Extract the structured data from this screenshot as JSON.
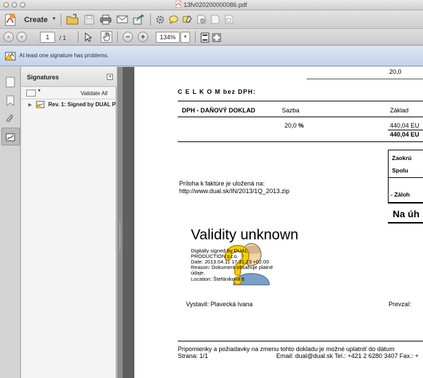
{
  "window": {
    "title": "13fv020200000086.pdf"
  },
  "toolbar": {
    "create_label": "Create",
    "page_current": "1",
    "page_total": "/ 1",
    "zoom": "134%"
  },
  "message_bar": {
    "text": "At least one signature has problems."
  },
  "signatures_panel": {
    "title": "Signatures",
    "validate_all": "Validate All",
    "entries": [
      {
        "label": "Rev. 1: Signed by DUAL P"
      }
    ]
  },
  "document": {
    "top_value": "20,0",
    "summary_heading": "C E L K O M  bez DPH:",
    "table": {
      "col_doc": "DPH - DAŇOVÝ DOKLAD",
      "col_rate": "Sazba",
      "col_base": "Základ",
      "rate": "20,0",
      "rate_unit": "%",
      "base_value": "440,04 EU",
      "base_total": "440,04 EU"
    },
    "right_labels": {
      "rounding": "Zaokrú",
      "total": "Spolu",
      "advance": "- Záloh",
      "to_pay": "Na úh"
    },
    "attachment_note": "Príloha k faktúre je uložená na:",
    "attachment_url": "http://www.dual.sk/IN/2013/1Q_2013.zip",
    "signature_stamp": {
      "title": "Validity unknown",
      "line1": "Digitally signed by DUAL",
      "line2": "PRODUCTION s.r.o.",
      "line3": "Date: 2013.04.11 17:31:15 +02:00",
      "line4": "Reason: Dokument obsahuje platné",
      "line5": "údaje.",
      "line6": "Location: Štefánikova 6"
    },
    "issued_by": "Vystavil:  Plavecká Ivana",
    "received_by": "Prevzal:",
    "footer_note": "Pripomienky a požiadavky na zmenu tohto dokladu je možné uplatniť do dátum",
    "footer_page": "Strana: 1/1",
    "footer_contact": "Email: dual@dual.sk  Tel.: +421 2 6280 3407  Fax.: +"
  },
  "colors": {
    "pdf_red": "#d9261c",
    "warning_yellow": "#f2c21b",
    "panel_bg": "#f4f4f4",
    "doc_bg": "#5f5f5f"
  }
}
